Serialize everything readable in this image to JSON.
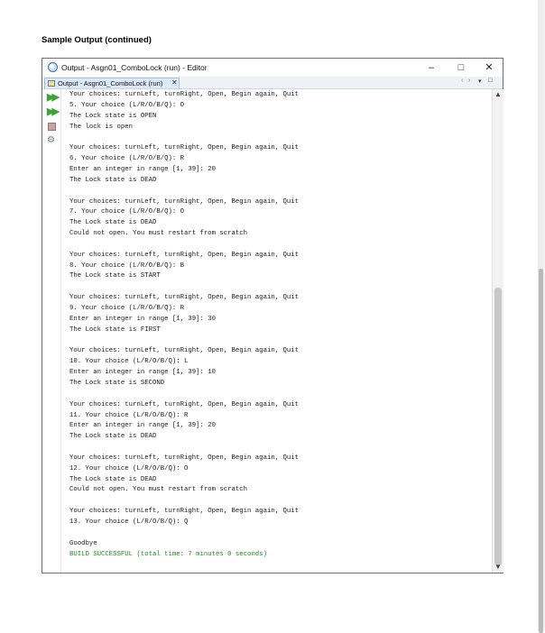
{
  "heading": "Sample Output (continued)",
  "window": {
    "title": "Output - Asgn01_ComboLock (run)  - Editor",
    "minimize": "–",
    "maximize": "□",
    "close": "✕"
  },
  "tab": {
    "label": "Output - Asgn01_ComboLock (run)",
    "close": "✕",
    "nav_left": "‹",
    "nav_right": "›",
    "dropdown": "▾",
    "restore": "□"
  },
  "scroll": {
    "up": "▲",
    "down": "▼"
  },
  "console_lines": [
    "Your choices: turnLeft, turnRight, Open, Begin again, Quit",
    "5. Your choice (L/R/O/B/Q): O",
    "The Lock state is OPEN",
    "The lock is open",
    "",
    "Your choices: turnLeft, turnRight, Open, Begin again, Quit",
    "6. Your choice (L/R/O/B/Q): R",
    "Enter an integer in range [1, 39]: 20",
    "The Lock state is DEAD",
    "",
    "Your choices: turnLeft, turnRight, Open, Begin again, Quit",
    "7. Your choice (L/R/O/B/Q): O",
    "The Lock state is DEAD",
    "Could not open. You must restart from scratch",
    "",
    "Your choices: turnLeft, turnRight, Open, Begin again, Quit",
    "8. Your choice (L/R/O/B/Q): B",
    "The Lock state is START",
    "",
    "Your choices: turnLeft, turnRight, Open, Begin again, Quit",
    "9. Your choice (L/R/O/B/Q): R",
    "Enter an integer in range [1, 39]: 30",
    "The Lock state is FIRST",
    "",
    "Your choices: turnLeft, turnRight, Open, Begin again, Quit",
    "10. Your choice (L/R/O/B/Q): L",
    "Enter an integer in range [1, 39]: 10",
    "The Lock state is SECOND",
    "",
    "Your choices: turnLeft, turnRight, Open, Begin again, Quit",
    "11. Your choice (L/R/O/B/Q): R",
    "Enter an integer in range [1, 39]: 20",
    "The Lock state is DEAD",
    "",
    "Your choices: turnLeft, turnRight, Open, Begin again, Quit",
    "12. Your choice (L/R/O/B/Q): O",
    "The Lock state is DEAD",
    "Could not open. You must restart from scratch",
    "",
    "Your choices: turnLeft, turnRight, Open, Begin again, Quit",
    "13. Your choice (L/R/O/B/Q): Q",
    "",
    "Goodbye",
    "BUILD SUCCESSFUL (total time: 7 minutes 0 seconds)"
  ],
  "success_line_index": 43,
  "gutter_icons": [
    "rerun-icon",
    "rerun-with-args-icon",
    "stop-icon",
    "settings-icon"
  ],
  "colors": {
    "success": "#1c8a1c",
    "text": "#1a1a1a"
  }
}
